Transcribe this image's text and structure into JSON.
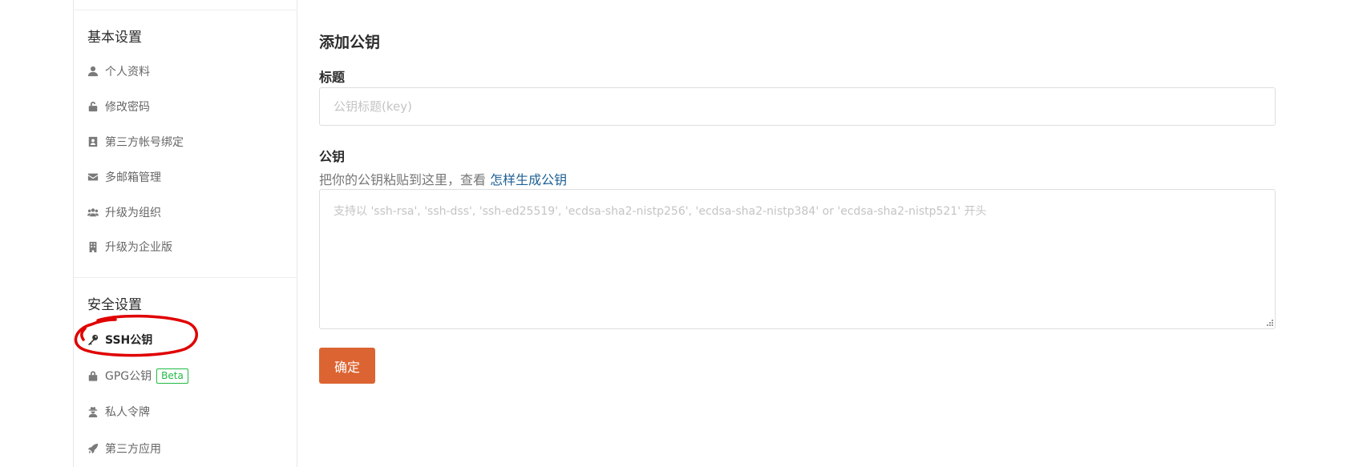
{
  "sidebar": {
    "basic_group": {
      "title": "基本设置",
      "items": [
        {
          "label": "个人资料",
          "icon": "user-icon"
        },
        {
          "label": "修改密码",
          "icon": "unlock-icon"
        },
        {
          "label": "第三方帐号绑定",
          "icon": "id-card-icon"
        },
        {
          "label": "多邮箱管理",
          "icon": "envelope-icon"
        },
        {
          "label": "升级为组织",
          "icon": "users-icon"
        },
        {
          "label": "升级为企业版",
          "icon": "building-icon"
        }
      ]
    },
    "security_group": {
      "title": "安全设置",
      "items": [
        {
          "label": "SSH公钥",
          "icon": "key-icon",
          "active": true
        },
        {
          "label": "GPG公钥",
          "icon": "lock-icon",
          "badge": "Beta"
        },
        {
          "label": "私人令牌",
          "icon": "user-secret-icon"
        },
        {
          "label": "第三方应用",
          "icon": "rocket-icon"
        }
      ]
    }
  },
  "main": {
    "title": "添加公钥",
    "title_field": {
      "label": "标题",
      "placeholder": "公钥标题(key)",
      "value": ""
    },
    "key_field": {
      "label": "公钥",
      "helper_text": "把你的公钥粘贴到这里，查看",
      "helper_link": "怎样生成公钥",
      "placeholder": "支持以 'ssh-rsa', 'ssh-dss', 'ssh-ed25519', 'ecdsa-sha2-nistp256', 'ecdsa-sha2-nistp384' or 'ecdsa-sha2-nistp521' 开头",
      "value": ""
    },
    "submit_label": "确定"
  },
  "colors": {
    "accent": "#dc6432",
    "link": "#1e5f94",
    "badge": "#21ba45",
    "annotation": "#e00000"
  }
}
